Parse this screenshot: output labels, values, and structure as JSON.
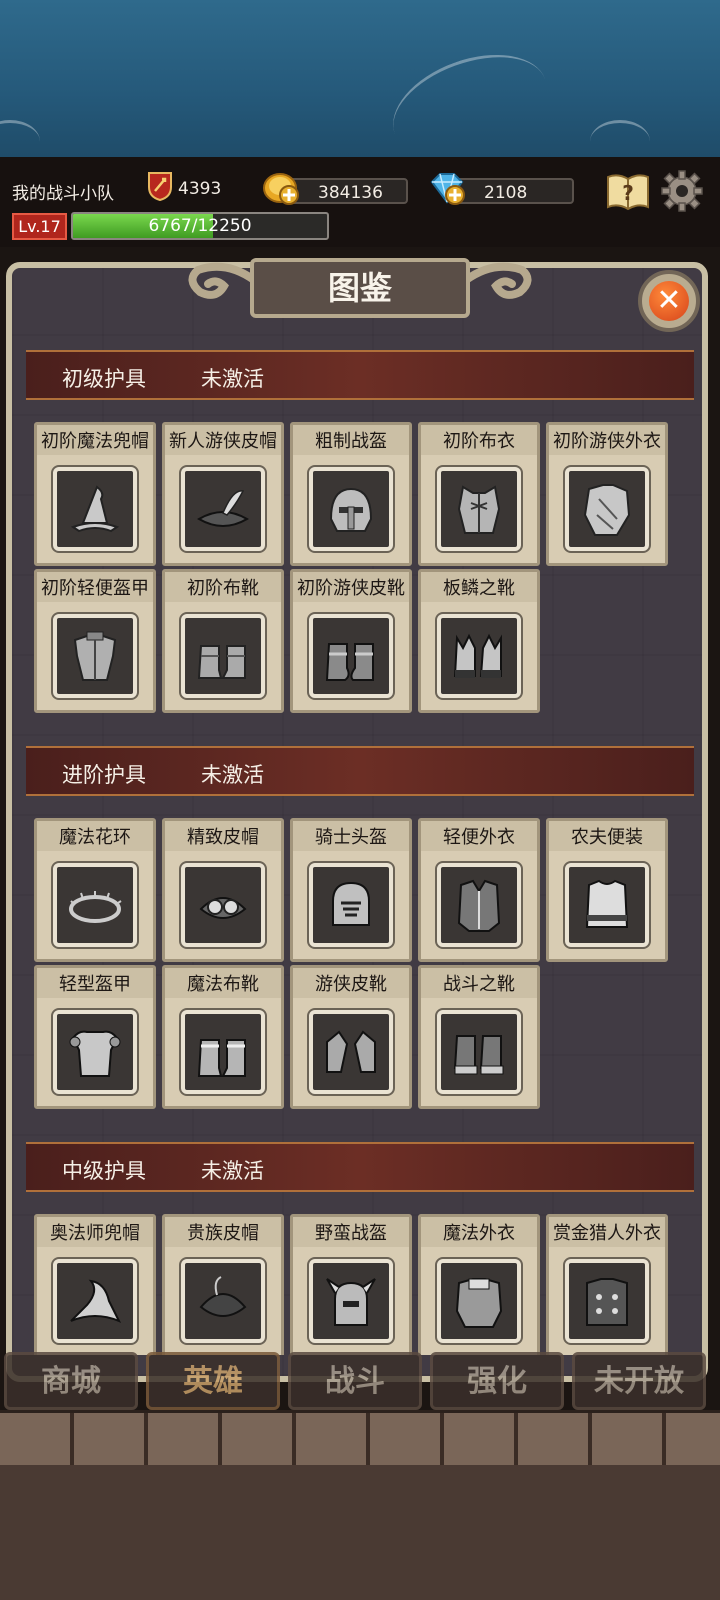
{
  "header": {
    "team_name": "我的战斗小队",
    "power": "4393",
    "gold": "384136",
    "gems": "2108",
    "level": "Lv.17",
    "xp_text": "6767/12250",
    "xp_fraction": 0.552
  },
  "panel": {
    "title": "图鉴",
    "close_label": "✕"
  },
  "sections": [
    {
      "name": "初级护具",
      "status": "未激活",
      "items": [
        {
          "label": "初阶魔法兜帽",
          "icon": "wizard-hat-icon"
        },
        {
          "label": "新人游侠皮帽",
          "icon": "feathered-cap-icon"
        },
        {
          "label": "粗制战盔",
          "icon": "helmet-icon"
        },
        {
          "label": "初阶布衣",
          "icon": "cloth-vest-icon"
        },
        {
          "label": "初阶游侠外衣",
          "icon": "ranger-coat-icon"
        },
        {
          "label": "初阶轻便盔甲",
          "icon": "light-armor-icon"
        },
        {
          "label": "初阶布靴",
          "icon": "cloth-boots-icon"
        },
        {
          "label": "初阶游侠皮靴",
          "icon": "leather-boots-icon"
        },
        {
          "label": "板鳞之靴",
          "icon": "plate-boots-icon"
        }
      ]
    },
    {
      "name": "进阶护具",
      "status": "未激活",
      "items": [
        {
          "label": "魔法花环",
          "icon": "thorn-wreath-icon"
        },
        {
          "label": "精致皮帽",
          "icon": "goggles-cap-icon"
        },
        {
          "label": "骑士头盔",
          "icon": "knight-helmet-icon"
        },
        {
          "label": "轻便外衣",
          "icon": "light-coat-icon"
        },
        {
          "label": "农夫便装",
          "icon": "farmer-shirt-icon"
        },
        {
          "label": "轻型盔甲",
          "icon": "chest-armor-icon"
        },
        {
          "label": "魔法布靴",
          "icon": "magic-boots-icon"
        },
        {
          "label": "游侠皮靴",
          "icon": "ranger-boots-icon"
        },
        {
          "label": "战斗之靴",
          "icon": "battle-boots-icon"
        }
      ]
    },
    {
      "name": "中级护具",
      "status": "未激活",
      "items": [
        {
          "label": "奥法师兜帽",
          "icon": "archmage-hood-icon"
        },
        {
          "label": "贵族皮帽",
          "icon": "noble-hat-icon"
        },
        {
          "label": "野蛮战盔",
          "icon": "horned-helmet-icon"
        },
        {
          "label": "魔法外衣",
          "icon": "magic-coat-icon"
        },
        {
          "label": "赏金猎人外衣",
          "icon": "bounty-coat-icon"
        }
      ]
    }
  ],
  "nav": [
    {
      "label": "商城"
    },
    {
      "label": "英雄"
    },
    {
      "label": "战斗"
    },
    {
      "label": "强化"
    },
    {
      "label": "未开放"
    }
  ]
}
